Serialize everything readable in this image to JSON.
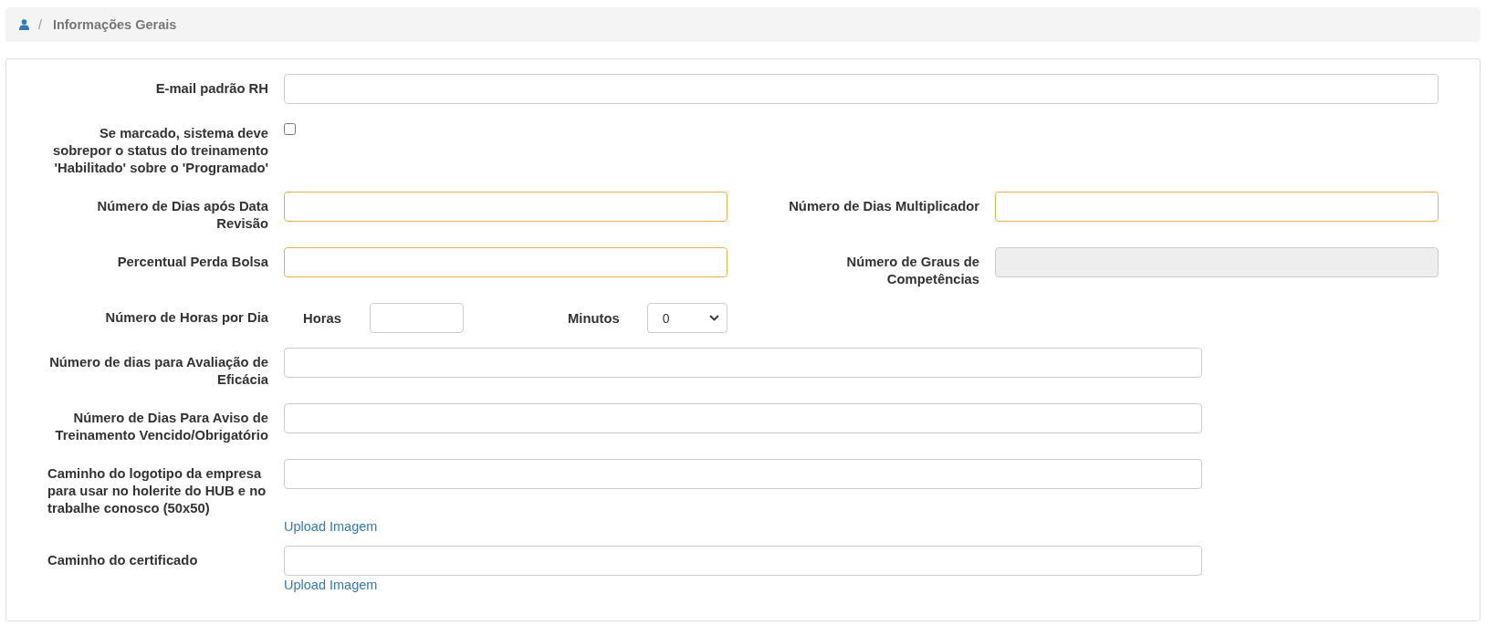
{
  "breadcrumb": {
    "items": [
      {
        "separator": "/",
        "label": "Informações Gerais"
      }
    ]
  },
  "top_fields": [
    {
      "kind": "text",
      "label": "E-mail padrão RH",
      "highlighted": false,
      "disabled": false
    },
    {
      "kind": "checkbox",
      "label": "Se marcado, sistema deve sobrepor o status do treinamento 'Habilitado' sobre o 'Programado'",
      "checked": false
    }
  ],
  "pairs": [
    [
      {
        "label": "Número de Dias após Data Revisão",
        "highlighted": true,
        "disabled": false
      },
      {
        "label": "Número de Dias Multiplicador",
        "highlighted": true,
        "disabled": false
      }
    ],
    [
      {
        "label": "Percentual Perda Bolsa",
        "highlighted": true,
        "disabled": false
      },
      {
        "label": "Número de Graus de Competências",
        "highlighted": false,
        "disabled": true
      }
    ]
  ],
  "hours": {
    "label": "Número de Horas por Dia",
    "hours_label": "Horas",
    "minutes_label": "Minutos",
    "minutes_value": "0"
  },
  "bottom_fields": [
    {
      "kind": "text",
      "label": "Número de dias para Avaliação de Eficácia",
      "highlighted": false,
      "disabled": false
    },
    {
      "kind": "text",
      "label": "Número de Dias Para Aviso de Treinamento Vencido/Obrigatório",
      "highlighted": false,
      "disabled": false
    },
    {
      "kind": "upload",
      "label": "Caminho do logotipo da empresa para usar no holerite do HUB e no trabalhe conosco (50x50)",
      "link": "Upload Imagem",
      "highlighted": false,
      "disabled": false
    },
    {
      "kind": "upload",
      "label": "Caminho do certificado",
      "link": "Upload Imagem",
      "highlighted": false,
      "disabled": false
    }
  ]
}
